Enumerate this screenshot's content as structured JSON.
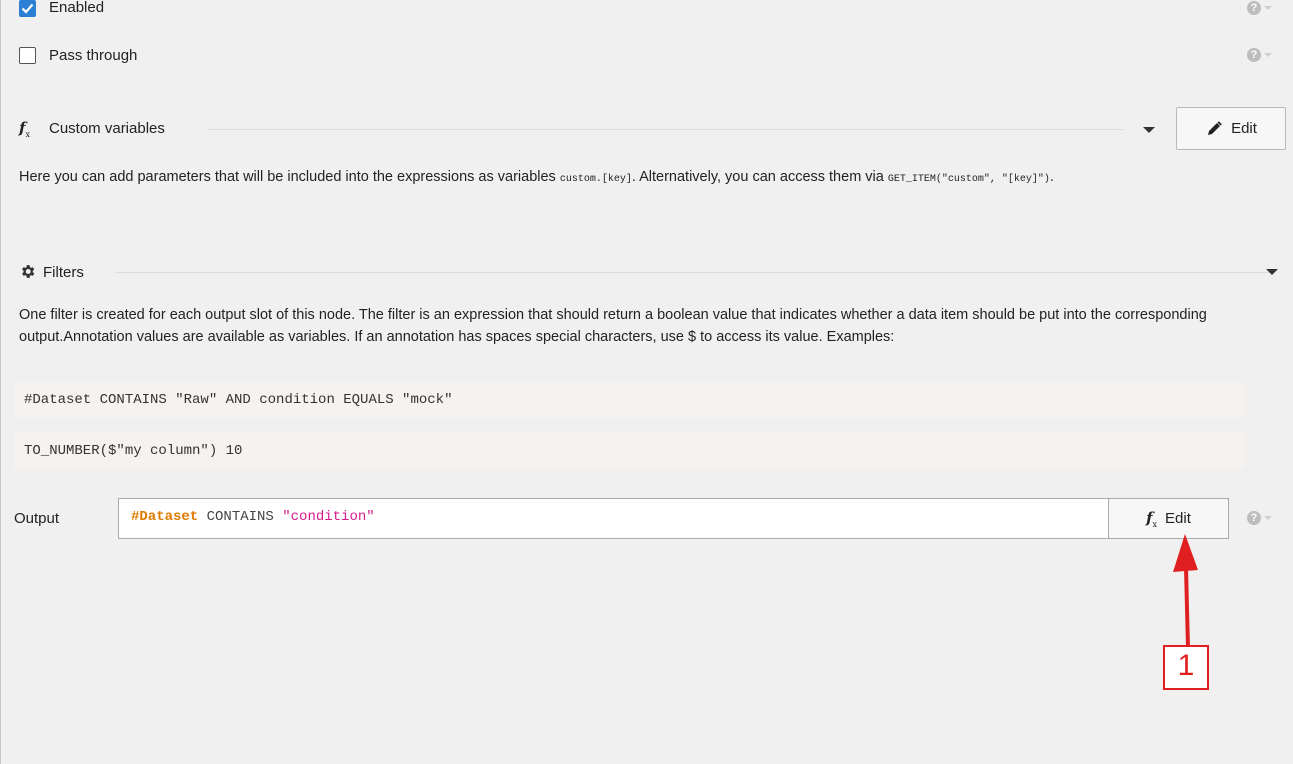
{
  "enabled": {
    "label": "Enabled",
    "checked": true
  },
  "pass_through": {
    "label": "Pass through",
    "checked": false
  },
  "custom_variables": {
    "title": "Custom variables",
    "edit_label": "Edit",
    "desc_part1": "Here you can add parameters that will be included into the expressions as variables ",
    "desc_code1": "custom.[key]",
    "desc_part2": ". Alternatively, you can access them via ",
    "desc_code2": "GET_ITEM(\"custom\", \"[key]\")",
    "desc_part3": "."
  },
  "filters": {
    "title": "Filters",
    "description": "One filter is created for each output slot of this node. The filter is an expression that should return a boolean value that indicates whether a data item should be put into the corresponding output.Annotation values are available as variables. If an annotation has spaces special characters, use $ to access its value. Examples:",
    "examples": [
      "#Dataset CONTAINS \"Raw\" AND condition EQUALS \"mock\"",
      "TO_NUMBER($\"my column\")  10"
    ]
  },
  "output": {
    "label": "Output",
    "expression": {
      "annotation": "#Dataset",
      "keyword": " CONTAINS ",
      "string": "\"condition\""
    },
    "edit_label": "Edit"
  },
  "annotation": {
    "number": "1",
    "color": "#e02020"
  },
  "icons": {
    "enabled_checkbox": "checkmark-icon",
    "help": "question-circle-icon",
    "custom_variables": "fx-icon",
    "edit": "pencil-icon",
    "filters": "gear-icon",
    "collapse": "caret-down-icon"
  }
}
